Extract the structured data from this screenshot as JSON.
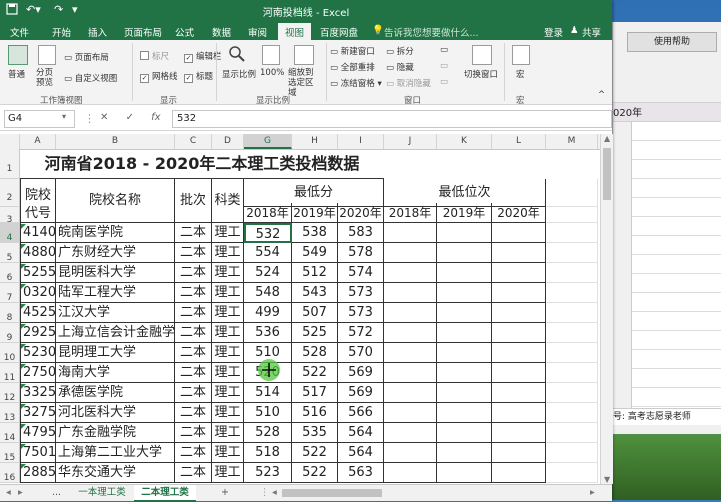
{
  "background_window": {
    "button_label": "使用帮助",
    "year_text": "020年",
    "status_text": "号: 高考志愿录老师"
  },
  "titlebar": {
    "title": "河南投档线 - Excel",
    "save_icon": "save-icon",
    "undo_icon": "undo-icon",
    "redo_icon": "redo-icon"
  },
  "tabs": [
    {
      "label": "文件"
    },
    {
      "label": "开始"
    },
    {
      "label": "插入"
    },
    {
      "label": "页面布局"
    },
    {
      "label": "公式"
    },
    {
      "label": "数据"
    },
    {
      "label": "审阅"
    },
    {
      "label": "视图"
    },
    {
      "label": "百度网盘"
    }
  ],
  "tell_me": "告诉我您想要做什么...",
  "signin": "登录",
  "share": "共享",
  "ribbon": {
    "normal": "普通",
    "page_break_preview": "分页预览",
    "page_layout": "页面布局",
    "custom_views": "自定义视图",
    "group_workbook_views": "工作簿视图",
    "ruler": "标尺",
    "gridlines": "网格线",
    "formula_bar": "编辑栏",
    "headings": "标题",
    "group_show": "显示",
    "zoom": "显示比例",
    "zoom_100": "100%",
    "zoom_selection": "缩放到选定区域",
    "group_zoom": "显示比例",
    "new_window": "新建窗口",
    "arrange_all": "全部重排",
    "freeze_panes": "冻结窗格",
    "split": "拆分",
    "hide": "隐藏",
    "unhide": "取消隐藏",
    "switch_windows": "切换窗口",
    "group_window": "窗口",
    "macros": "宏",
    "group_macros": "宏"
  },
  "formula_bar": {
    "name_box": "G4",
    "cancel": "✕",
    "enter": "✓",
    "fx": "fx",
    "value": "532"
  },
  "columns": [
    "A",
    "B",
    "C",
    "D",
    "G",
    "H",
    "I",
    "J",
    "K",
    "L",
    "M"
  ],
  "selected_column": "G",
  "row_numbers": [
    "1",
    "2",
    "3",
    "4",
    "5",
    "6",
    "7",
    "8",
    "9",
    "10",
    "11",
    "12",
    "13",
    "14",
    "15",
    "16"
  ],
  "sheet": {
    "title": "河南省2018 - 2020年二本理工类投档数据",
    "hdr_code": "院校代号",
    "hdr_name": "院校名称",
    "hdr_batch": "批次",
    "hdr_subject": "科类",
    "hdr_min_score": "最低分",
    "hdr_min_rank": "最低位次",
    "years": [
      "2018年",
      "2019年",
      "2020年",
      "2018年",
      "2019年",
      "2020年"
    ],
    "rows": [
      {
        "code": "4140",
        "name": "皖南医学院",
        "batch": "二本",
        "subject": "理工",
        "s2018": "532",
        "s2019": "538",
        "s2020": "583"
      },
      {
        "code": "4880",
        "name": "广东财经大学",
        "batch": "二本",
        "subject": "理工",
        "s2018": "554",
        "s2019": "549",
        "s2020": "578"
      },
      {
        "code": "5255",
        "name": "昆明医科大学",
        "batch": "二本",
        "subject": "理工",
        "s2018": "524",
        "s2019": "512",
        "s2020": "574"
      },
      {
        "code": "0320",
        "name": "陆军工程大学",
        "batch": "二本",
        "subject": "理工",
        "s2018": "548",
        "s2019": "543",
        "s2020": "573"
      },
      {
        "code": "4525",
        "name": "江汉大学",
        "batch": "二本",
        "subject": "理工",
        "s2018": "499",
        "s2019": "507",
        "s2020": "573"
      },
      {
        "code": "2925",
        "name": "上海立信会计金融学",
        "batch": "二本",
        "subject": "理工",
        "s2018": "536",
        "s2019": "525",
        "s2020": "572"
      },
      {
        "code": "5230",
        "name": "昆明理工大学",
        "batch": "二本",
        "subject": "理工",
        "s2018": "510",
        "s2019": "528",
        "s2020": "570"
      },
      {
        "code": "2750",
        "name": "海南大学",
        "batch": "二本",
        "subject": "理工",
        "s2018": "520",
        "s2019": "522",
        "s2020": "569"
      },
      {
        "code": "3325",
        "name": "承德医学院",
        "batch": "二本",
        "subject": "理工",
        "s2018": "514",
        "s2019": "517",
        "s2020": "569"
      },
      {
        "code": "3275",
        "name": "河北医科大学",
        "batch": "二本",
        "subject": "理工",
        "s2018": "510",
        "s2019": "516",
        "s2020": "566"
      },
      {
        "code": "4795",
        "name": "广东金融学院",
        "batch": "二本",
        "subject": "理工",
        "s2018": "528",
        "s2019": "535",
        "s2020": "564"
      },
      {
        "code": "7501",
        "name": "上海第二工业大学",
        "batch": "二本",
        "subject": "理工",
        "s2018": "518",
        "s2019": "522",
        "s2020": "564"
      },
      {
        "code": "2885",
        "name": "华东交通大学",
        "batch": "二本",
        "subject": "理工",
        "s2018": "523",
        "s2019": "522",
        "s2020": "563"
      }
    ]
  },
  "sheet_tabs": {
    "more": "...",
    "tab1": "一本理工类",
    "tab2": "二本理工类",
    "add": "+"
  },
  "colors": {
    "excel_green": "#217346",
    "ribbon_bg": "#f3f3f3"
  }
}
